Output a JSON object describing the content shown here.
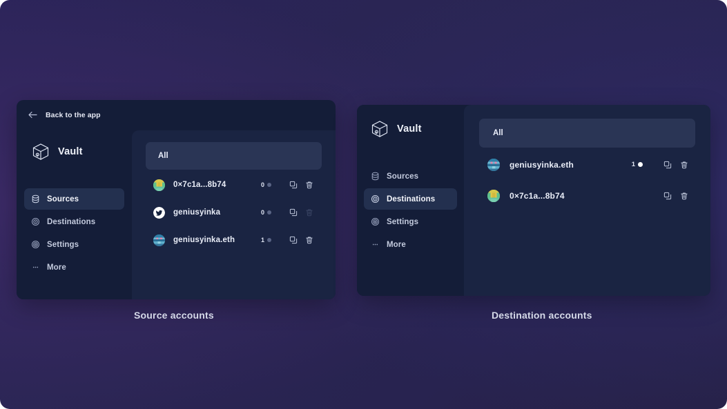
{
  "colors": {
    "page_bg": "#2b2459",
    "card_bg": "#141d38",
    "content_bg": "#1a2442",
    "filter_bar_bg": "#2a3555",
    "nav_active_bg": "#23304f",
    "text_primary": "#eef1f8",
    "text_muted": "#98a2bd",
    "badge_dot": "#5a6585",
    "badge_dot_bright": "#ffffff"
  },
  "left_panel": {
    "topbar": {
      "back_icon": "arrow-left-icon",
      "back_label": "Back to the app"
    },
    "brand": {
      "logo_icon": "vault-cube-icon",
      "name": "Vault"
    },
    "nav": {
      "items": [
        {
          "label": "Sources",
          "icon": "database-icon",
          "active": true
        },
        {
          "label": "Destinations",
          "icon": "target-icon",
          "active": false
        },
        {
          "label": "Settings",
          "icon": "gear-icon",
          "active": false
        },
        {
          "label": "More",
          "icon": "ellipsis-icon",
          "active": false
        }
      ]
    },
    "filter": {
      "label": "All"
    },
    "accounts": [
      {
        "name": "0×7c1a...8b74",
        "avatar": "blockie-green-avatar",
        "count": "0",
        "dot_bright": false,
        "copy_enabled": true,
        "delete_enabled": true
      },
      {
        "name": "geniusyinka",
        "avatar": "twitter-avatar",
        "count": "0",
        "dot_bright": false,
        "copy_enabled": true,
        "delete_enabled": false
      },
      {
        "name": "geniusyinka.eth",
        "avatar": "blockie-blue-avatar",
        "count": "1",
        "dot_bright": false,
        "copy_enabled": true,
        "delete_enabled": true
      }
    ]
  },
  "right_panel": {
    "brand": {
      "logo_icon": "vault-cube-icon",
      "name": "Vault"
    },
    "nav": {
      "items": [
        {
          "label": "Sources",
          "icon": "database-icon",
          "active": false
        },
        {
          "label": "Destinations",
          "icon": "target-icon",
          "active": true
        },
        {
          "label": "Settings",
          "icon": "gear-icon",
          "active": false
        },
        {
          "label": "More",
          "icon": "ellipsis-icon",
          "active": false
        }
      ]
    },
    "filter": {
      "label": "All"
    },
    "accounts": [
      {
        "name": "geniusyinka.eth",
        "avatar": "blockie-blue-avatar",
        "count": "1",
        "dot_bright": true,
        "copy_enabled": true,
        "delete_enabled": true
      },
      {
        "name": "0×7c1a...8b74",
        "avatar": "blockie-green-avatar",
        "count": "",
        "dot_bright": false,
        "copy_enabled": true,
        "delete_enabled": true
      }
    ]
  },
  "captions": {
    "left": "Source accounts",
    "right": "Destination accounts"
  }
}
